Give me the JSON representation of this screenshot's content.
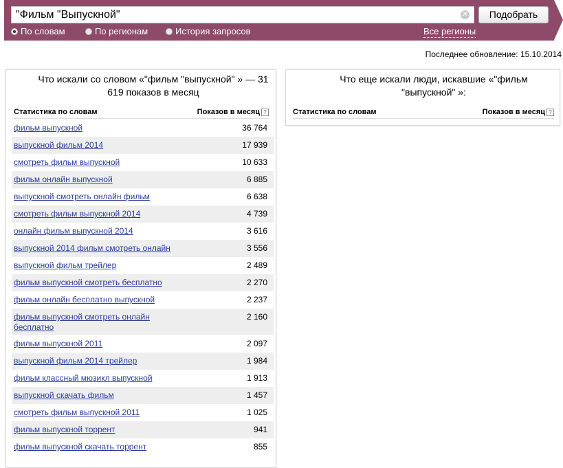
{
  "search": {
    "query": "\"Фильм \"Выпускной\"",
    "submit_label": "Подобрать",
    "modes": [
      {
        "label": "По словам",
        "checked": true
      },
      {
        "label": "По регионам",
        "checked": false
      },
      {
        "label": "История запросов",
        "checked": false
      }
    ],
    "regions_link": "Все регионы"
  },
  "last_update": "Последнее обновление: 15.10.2014",
  "left_panel": {
    "title": "Что искали со словом «\"фильм \"выпускной\" » — 31 619 показов в месяц",
    "col_word": "Статистика по словам",
    "col_count": "Показов в месяц",
    "rows": [
      {
        "phrase": "фильм выпускной",
        "count": "36 764"
      },
      {
        "phrase": "выпускной фильм 2014",
        "count": "17 939"
      },
      {
        "phrase": "смотреть фильм выпускной",
        "count": "10 633"
      },
      {
        "phrase": "фильм онлайн выпускной",
        "count": "6 885"
      },
      {
        "phrase": "выпускной смотреть онлайн фильм",
        "count": "6 638"
      },
      {
        "phrase": "смотреть фильм выпускной 2014",
        "count": "4 739"
      },
      {
        "phrase": "онлайн фильм выпускной 2014",
        "count": "3 616"
      },
      {
        "phrase": "выпускной 2014 фильм смотреть онлайн",
        "count": "3 556"
      },
      {
        "phrase": "выпускной фильм трейлер",
        "count": "2 489"
      },
      {
        "phrase": "фильм выпускной смотреть бесплатно",
        "count": "2 270"
      },
      {
        "phrase": "фильм онлайн бесплатно выпускной",
        "count": "2 237"
      },
      {
        "phrase": "фильм выпускной смотреть онлайн бесплатно",
        "count": "2 160"
      },
      {
        "phrase": "фильм выпускной 2011",
        "count": "2 097"
      },
      {
        "phrase": "выпускной фильм 2014 трейлер",
        "count": "1 984"
      },
      {
        "phrase": "фильм классный мюзикл выпускной",
        "count": "1 913"
      },
      {
        "phrase": "выпускной скачать фильм",
        "count": "1 457"
      },
      {
        "phrase": "смотреть фильм выпускной 2011",
        "count": "1 025"
      },
      {
        "phrase": "фильм выпускной торрент",
        "count": "941"
      },
      {
        "phrase": "фильм выпускной скачать торрент",
        "count": "855"
      }
    ]
  },
  "right_panel": {
    "title": "Что еще искали люди, искавшие «\"фильм \"выпускной\" »:",
    "col_word": "Статистика по словам",
    "col_count": "Показов в месяц"
  }
}
